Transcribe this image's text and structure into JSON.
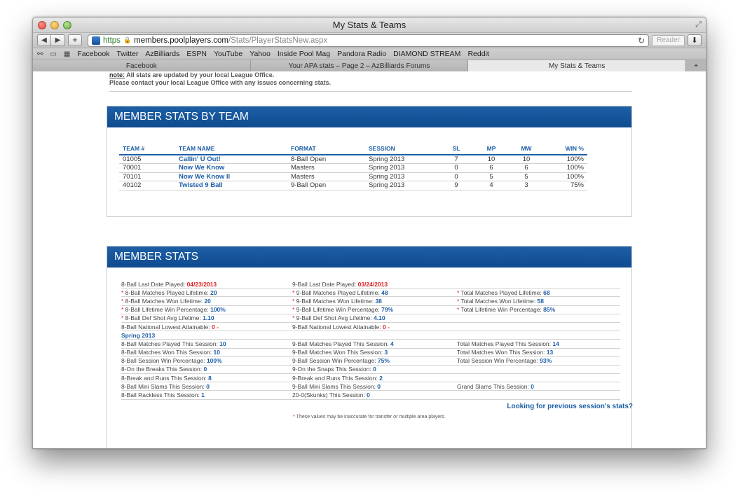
{
  "window": {
    "title": "My Stats & Teams"
  },
  "toolbar": {
    "url_scheme": "https",
    "url_host": "members.poolplayers.com",
    "url_path": "/Stats/PlayerStatsNew.aspx",
    "reader_label": "Reader"
  },
  "bookmarks": [
    "Facebook",
    "Twitter",
    "AzBilliards",
    "ESPN",
    "YouTube",
    "Yahoo",
    "Inside Pool Mag",
    "Pandora Radio",
    "DIAMOND STREAM",
    "Reddit"
  ],
  "tabs": [
    "Facebook",
    "Your APA stats – Page 2 – AzBilliards Forums",
    "My Stats & Teams"
  ],
  "note": {
    "label": "note:",
    "line1": " All stats are updated by your local League Office.",
    "line2": "Please contact your local League Office with any issues concerning stats."
  },
  "teams_panel": {
    "title": "MEMBER STATS BY TEAM",
    "headers": [
      "TEAM #",
      "TEAM NAME",
      "FORMAT",
      "SESSION",
      "SL",
      "MP",
      "MW",
      "WIN %"
    ],
    "rows": [
      [
        "01005",
        "Callin' U Out!",
        "8-Ball Open",
        "Spring 2013",
        "7",
        "10",
        "10",
        "100%"
      ],
      [
        "70001",
        "Now We Know",
        "Masters",
        "Spring 2013",
        "0",
        "6",
        "6",
        "100%"
      ],
      [
        "70101",
        "Now We Know II",
        "Masters",
        "Spring 2013",
        "0",
        "5",
        "5",
        "100%"
      ],
      [
        "40102",
        "Twisted 9 Ball",
        "9-Ball Open",
        "Spring 2013",
        "9",
        "4",
        "3",
        "75%"
      ]
    ]
  },
  "stats_panel": {
    "title": "MEMBER STATS",
    "rows": [
      [
        {
          "star": false,
          "label": "8-Ball Last Date Played: ",
          "value": "04/23/2013",
          "red": true
        },
        {
          "star": false,
          "label": "9-Ball Last Date Played: ",
          "value": "03/24/2013",
          "red": true
        },
        null
      ],
      [
        {
          "star": true,
          "label": " 8-Ball Matches Played Lifetime: ",
          "value": "20"
        },
        {
          "star": true,
          "label": " 9-Ball Matches Played Lifetime: ",
          "value": "48"
        },
        {
          "star": true,
          "label": " Total Matches Played Lifetime: ",
          "value": "68"
        }
      ],
      [
        {
          "star": true,
          "label": " 8-Ball Matches Won Lifetime: ",
          "value": "20"
        },
        {
          "star": true,
          "label": " 9-Ball Matches Won Lifetime: ",
          "value": "38"
        },
        {
          "star": true,
          "label": " Total Matches Won Lifetime: ",
          "value": "58"
        }
      ],
      [
        {
          "star": true,
          "label": " 8-Ball Lifetime Win Percentage: ",
          "value": "100%"
        },
        {
          "star": true,
          "label": " 9-Ball Lifetime Win Percentage: ",
          "value": "79%"
        },
        {
          "star": true,
          "label": " Total Lifetime Win Percentage: ",
          "value": "85%"
        }
      ],
      [
        {
          "star": true,
          "label": " 8-Ball Def Shot Avg Lifetime: ",
          "value": "1.10"
        },
        {
          "star": true,
          "label": " 9-Ball Def Shot Avg Lifetime: ",
          "value": "4.10"
        },
        null
      ],
      [
        {
          "star": false,
          "label": "8-Ball National Lowest Attainable: ",
          "value": "0 -",
          "red": true
        },
        {
          "star": false,
          "label": "9-Ball National Lowest Attainable: ",
          "value": "0 -",
          "red": true
        },
        null
      ],
      "Spring 2013",
      [
        {
          "star": false,
          "label": "8-Ball Matches Played This Session: ",
          "value": "10"
        },
        {
          "star": false,
          "label": "9-Ball Matches Played This Session: ",
          "value": "4"
        },
        {
          "star": false,
          "label": "Total Matches Played This Session: ",
          "value": "14"
        }
      ],
      [
        {
          "star": false,
          "label": "8-Ball Matches Won This Session: ",
          "value": "10"
        },
        {
          "star": false,
          "label": "9-Ball Matches Won This Session: ",
          "value": "3"
        },
        {
          "star": false,
          "label": "Total Matches Won This Session: ",
          "value": "13"
        }
      ],
      [
        {
          "star": false,
          "label": "8-Ball Session Win Percentage: ",
          "value": "100%"
        },
        {
          "star": false,
          "label": "9-Ball Session Win Percentage: ",
          "value": "75%"
        },
        {
          "star": false,
          "label": "Total Session Win Percentage: ",
          "value": "93%"
        }
      ],
      [
        {
          "star": false,
          "label": "8-On the Breaks This Session: ",
          "value": "0"
        },
        {
          "star": false,
          "label": "9-On the Snaps This Session: ",
          "value": "0"
        },
        null
      ],
      [
        {
          "star": false,
          "label": "8-Break and Runs This Session: ",
          "value": "8"
        },
        {
          "star": false,
          "label": "9-Break and Runs This Session: ",
          "value": "2"
        },
        null
      ],
      [
        {
          "star": false,
          "label": "8-Ball Mini Slams This Session: ",
          "value": "0"
        },
        {
          "star": false,
          "label": "9-Ball Mini Slams This Session: ",
          "value": "0"
        },
        {
          "star": false,
          "label": "Grand Slams This Session: ",
          "value": "0"
        }
      ],
      [
        {
          "star": false,
          "label": "8-Ball Rackless This Session: ",
          "value": "1"
        },
        {
          "star": false,
          "label": "20-0(Skunks) This Session: ",
          "value": "0"
        },
        null
      ]
    ],
    "previous_link": "Looking for previous session's stats?",
    "footnote": "These values may be inaccurate for transfer or multiple area players."
  },
  "colors": {
    "accent": "#1d5fa6",
    "highlight_red": "#e02020"
  }
}
